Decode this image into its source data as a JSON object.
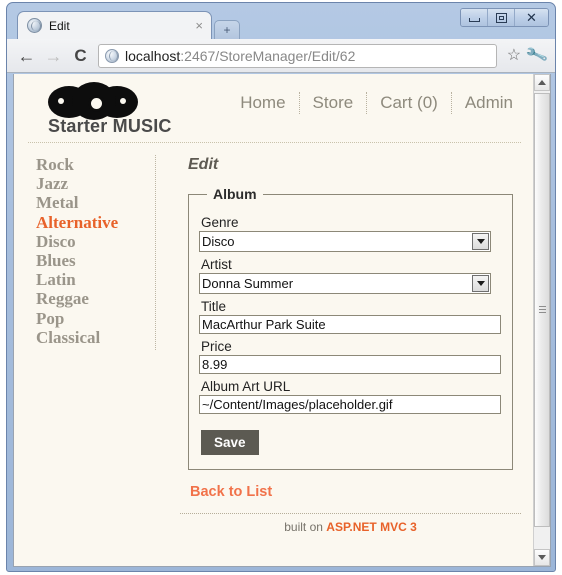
{
  "browser": {
    "tab": {
      "title": "Edit",
      "close_label": "×",
      "new_tab_label": "+"
    },
    "window_controls": {
      "minimize": "minimize-icon",
      "maximize": "maximize-icon",
      "close": "✕"
    },
    "nav": {
      "back": "←",
      "forward": "→",
      "reload": "C"
    },
    "url": {
      "host": "localhost",
      "rest": ":2467/StoreManager/Edit/62",
      "full": "localhost:2467/StoreManager/Edit/62"
    },
    "star_icon": "☆",
    "wrench_icon": "🔧"
  },
  "site": {
    "title": "Starter MUSIC",
    "logo_icon": "vinyl-records-logo",
    "nav_links": [
      "Home",
      "Store",
      "Cart (0)",
      "Admin"
    ]
  },
  "genres": {
    "items": [
      "Rock",
      "Jazz",
      "Metal",
      "Alternative",
      "Disco",
      "Blues",
      "Latin",
      "Reggae",
      "Pop",
      "Classical"
    ],
    "active": "Alternative",
    "active_color": "#e8622a"
  },
  "page": {
    "heading": "Edit",
    "fieldset_legend": "Album",
    "fields": {
      "genre": {
        "label": "Genre",
        "value": "Disco",
        "type": "select"
      },
      "artist": {
        "label": "Artist",
        "value": "Donna Summer",
        "type": "select"
      },
      "title": {
        "label": "Title",
        "value": "MacArthur Park Suite",
        "type": "text"
      },
      "price": {
        "label": "Price",
        "value": "8.99",
        "type": "text"
      },
      "art_url": {
        "label": "Album Art URL",
        "value": "~/Content/Images/placeholder.gif",
        "type": "text"
      }
    },
    "save_label": "Save",
    "back_link": "Back to List",
    "footer_prefix": "built on ",
    "footer_link": "ASP.NET MVC 3"
  },
  "scrollbar": {
    "up": "▲",
    "down": "▼"
  }
}
